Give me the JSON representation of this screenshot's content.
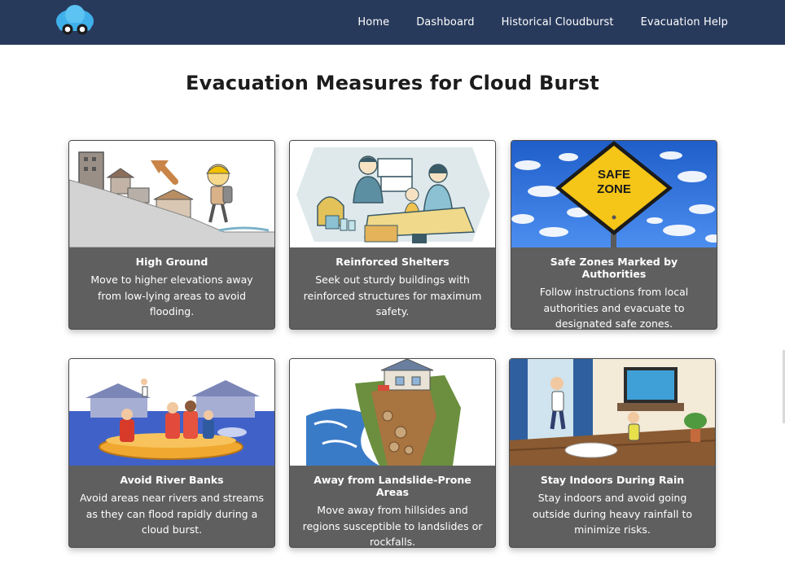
{
  "nav": {
    "logo_icon": "cloud-car-icon",
    "links": [
      "Home",
      "Dashboard",
      "Historical Cloudburst",
      "Evacuation Help"
    ]
  },
  "page": {
    "title": "Evacuation Measures for Cloud Burst"
  },
  "cards": [
    {
      "title": "High Ground",
      "text": "Move to higher elevations away from low-lying areas to avoid flooding.",
      "image_icon": "hiker-climbing-hill-illustration"
    },
    {
      "title": "Reinforced Shelters",
      "text": "Seek out sturdy buildings with reinforced structures for maximum safety.",
      "image_icon": "family-in-shelter-illustration"
    },
    {
      "title": "Safe Zones Marked by Authorities",
      "text": "Follow instructions from local authorities and evacuate to designated safe zones.",
      "image_icon": "safe-zone-sign-photo"
    },
    {
      "title": "Avoid River Banks",
      "text": "Avoid areas near rivers and streams as they can flood rapidly during a cloud burst.",
      "image_icon": "flood-rescue-boat-illustration"
    },
    {
      "title": "Away from Landslide-Prone Areas",
      "text": "Move away from hillsides and regions susceptible to landslides or rockfalls.",
      "image_icon": "landslide-house-illustration"
    },
    {
      "title": "Stay Indoors During Rain",
      "text": "Stay indoors and avoid going outside during heavy rainfall to minimize risks.",
      "image_icon": "children-indoors-illustration"
    }
  ],
  "safe_zone_sign": {
    "line1": "SAFE",
    "line2": "ZONE"
  },
  "colors": {
    "navbar": "#283a5c",
    "card_body": "#5f5f5f",
    "sign_yellow": "#f5c518",
    "sky_blue": "#2f6fd6"
  }
}
